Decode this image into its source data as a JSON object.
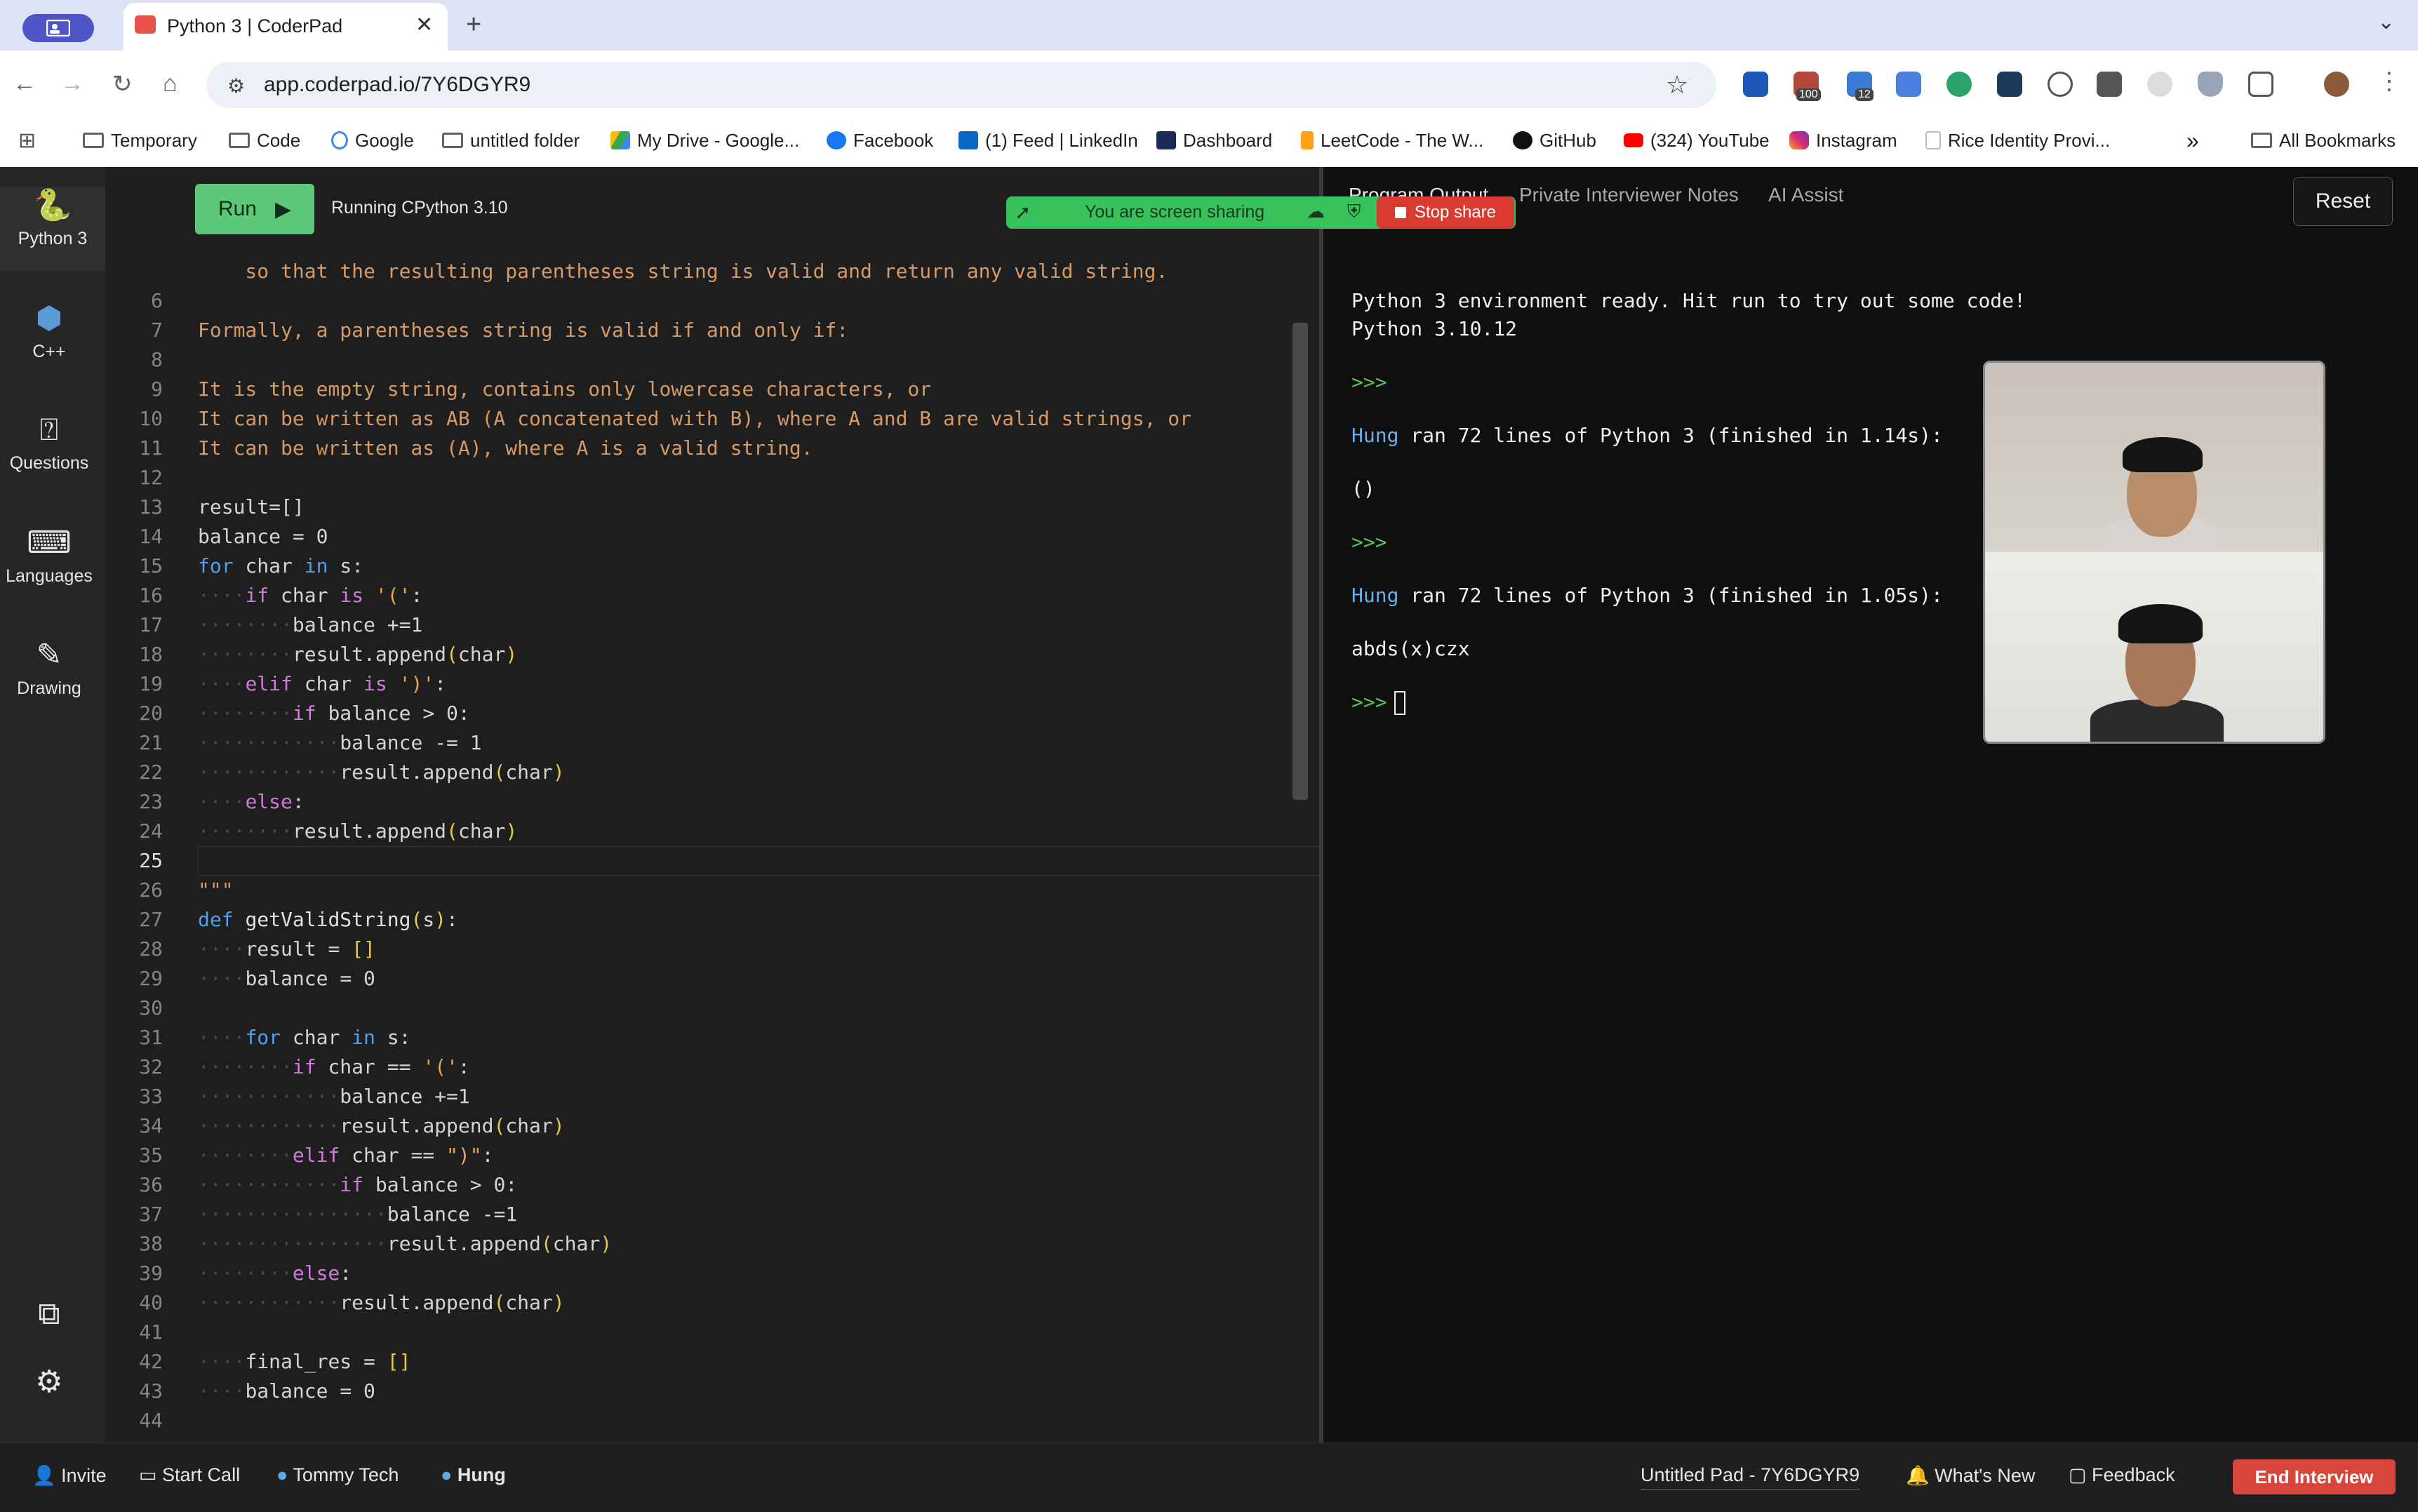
{
  "browser": {
    "tab_title": "Python 3 | CoderPad",
    "url": "app.coderpad.io/7Y6DGYR9",
    "ext_badge_1": "100",
    "ext_badge_2": "12",
    "bookmarks": [
      "Temporary",
      "Code",
      "Google",
      "untitled folder",
      "My Drive - Google...",
      "Facebook",
      "(1) Feed | LinkedIn",
      "Dashboard",
      "LeetCode - The W...",
      "GitHub",
      "(324) YouTube",
      "Instagram",
      "Rice Identity Provi..."
    ],
    "all_bookmarks": "All Bookmarks",
    "overflow": "»"
  },
  "sidebar": {
    "items": [
      {
        "label": "Python 3",
        "icon": "python-icon"
      },
      {
        "label": "C++",
        "icon": "cpp-icon"
      },
      {
        "label": "Questions",
        "icon": "question-icon"
      },
      {
        "label": "Languages",
        "icon": "terminal-icon"
      },
      {
        "label": "Drawing",
        "icon": "pen-icon"
      }
    ]
  },
  "editor": {
    "run_label": "Run",
    "status": "Running CPython 3.10",
    "lines": [
      {
        "n": "",
        "t": "    so that the resulting parentheses string is valid and return any valid string."
      },
      {
        "n": "6",
        "t": ""
      },
      {
        "n": "7",
        "t": "Formally, a parentheses string is valid if and only if:"
      },
      {
        "n": "8",
        "t": ""
      },
      {
        "n": "9",
        "t": "It is the empty string, contains only lowercase characters, or"
      },
      {
        "n": "10",
        "t": "It can be written as AB (A concatenated with B), where A and B are valid strings, or"
      },
      {
        "n": "11",
        "t": "It can be written as (A), where A is a valid string."
      },
      {
        "n": "12",
        "t": ""
      },
      {
        "n": "13",
        "t": "result=[]"
      },
      {
        "n": "14",
        "t": "balance = 0"
      },
      {
        "n": "15",
        "t": "for char in s:"
      },
      {
        "n": "16",
        "t": "    if char is '(':"
      },
      {
        "n": "17",
        "t": "        balance +=1"
      },
      {
        "n": "18",
        "t": "        result.append(char)"
      },
      {
        "n": "19",
        "t": "    elif char is ')':"
      },
      {
        "n": "20",
        "t": "        if balance > 0:"
      },
      {
        "n": "21",
        "t": "            balance -= 1"
      },
      {
        "n": "22",
        "t": "            result.append(char)"
      },
      {
        "n": "23",
        "t": "    else:"
      },
      {
        "n": "24",
        "t": "        result.append(char)"
      },
      {
        "n": "25",
        "t": ""
      },
      {
        "n": "26",
        "t": "\"\"\""
      },
      {
        "n": "27",
        "t": "def getValidString(s):"
      },
      {
        "n": "28",
        "t": "    result = []"
      },
      {
        "n": "29",
        "t": "    balance = 0"
      },
      {
        "n": "30",
        "t": ""
      },
      {
        "n": "31",
        "t": "    for char in s:"
      },
      {
        "n": "32",
        "t": "        if char == '(':"
      },
      {
        "n": "33",
        "t": "            balance +=1"
      },
      {
        "n": "34",
        "t": "            result.append(char)"
      },
      {
        "n": "35",
        "t": "        elif char == \")\":"
      },
      {
        "n": "36",
        "t": "            if balance > 0:"
      },
      {
        "n": "37",
        "t": "                balance -=1"
      },
      {
        "n": "38",
        "t": "                result.append(char)"
      },
      {
        "n": "39",
        "t": "        else:"
      },
      {
        "n": "40",
        "t": "            result.append(char)"
      },
      {
        "n": "41",
        "t": ""
      },
      {
        "n": "42",
        "t": "    final_res = []"
      },
      {
        "n": "43",
        "t": "    balance = 0"
      },
      {
        "n": "44",
        "t": ""
      }
    ]
  },
  "output": {
    "tabs": [
      "Program Output",
      "Private Interviewer Notes",
      "AI Assist"
    ],
    "reset": "Reset",
    "ready_1": "Python 3 environment ready. Hit run to try out some code!",
    "ready_2": "Python 3.10.12",
    "prompt": ">>>",
    "user": "Hung",
    "run1": " ran 72 lines of Python 3 (finished in 1.14s):",
    "result1": "()",
    "run2": " ran 72 lines of Python 3 (finished in 1.05s):",
    "result2": "abds(x)czx"
  },
  "share": {
    "text": "You are screen sharing",
    "stop": "Stop share"
  },
  "bottom": {
    "invite": "Invite",
    "start_call": "Start Call",
    "user1": "Tommy Tech",
    "user2": "Hung",
    "pad_name": "Untitled Pad - 7Y6DGYR9",
    "whats_new": "What's New",
    "feedback": "Feedback",
    "end": "End Interview"
  },
  "colors": {
    "run": "#5cc97a",
    "end": "#d8453b",
    "share": "#38c25b",
    "stop": "#d93b30"
  }
}
